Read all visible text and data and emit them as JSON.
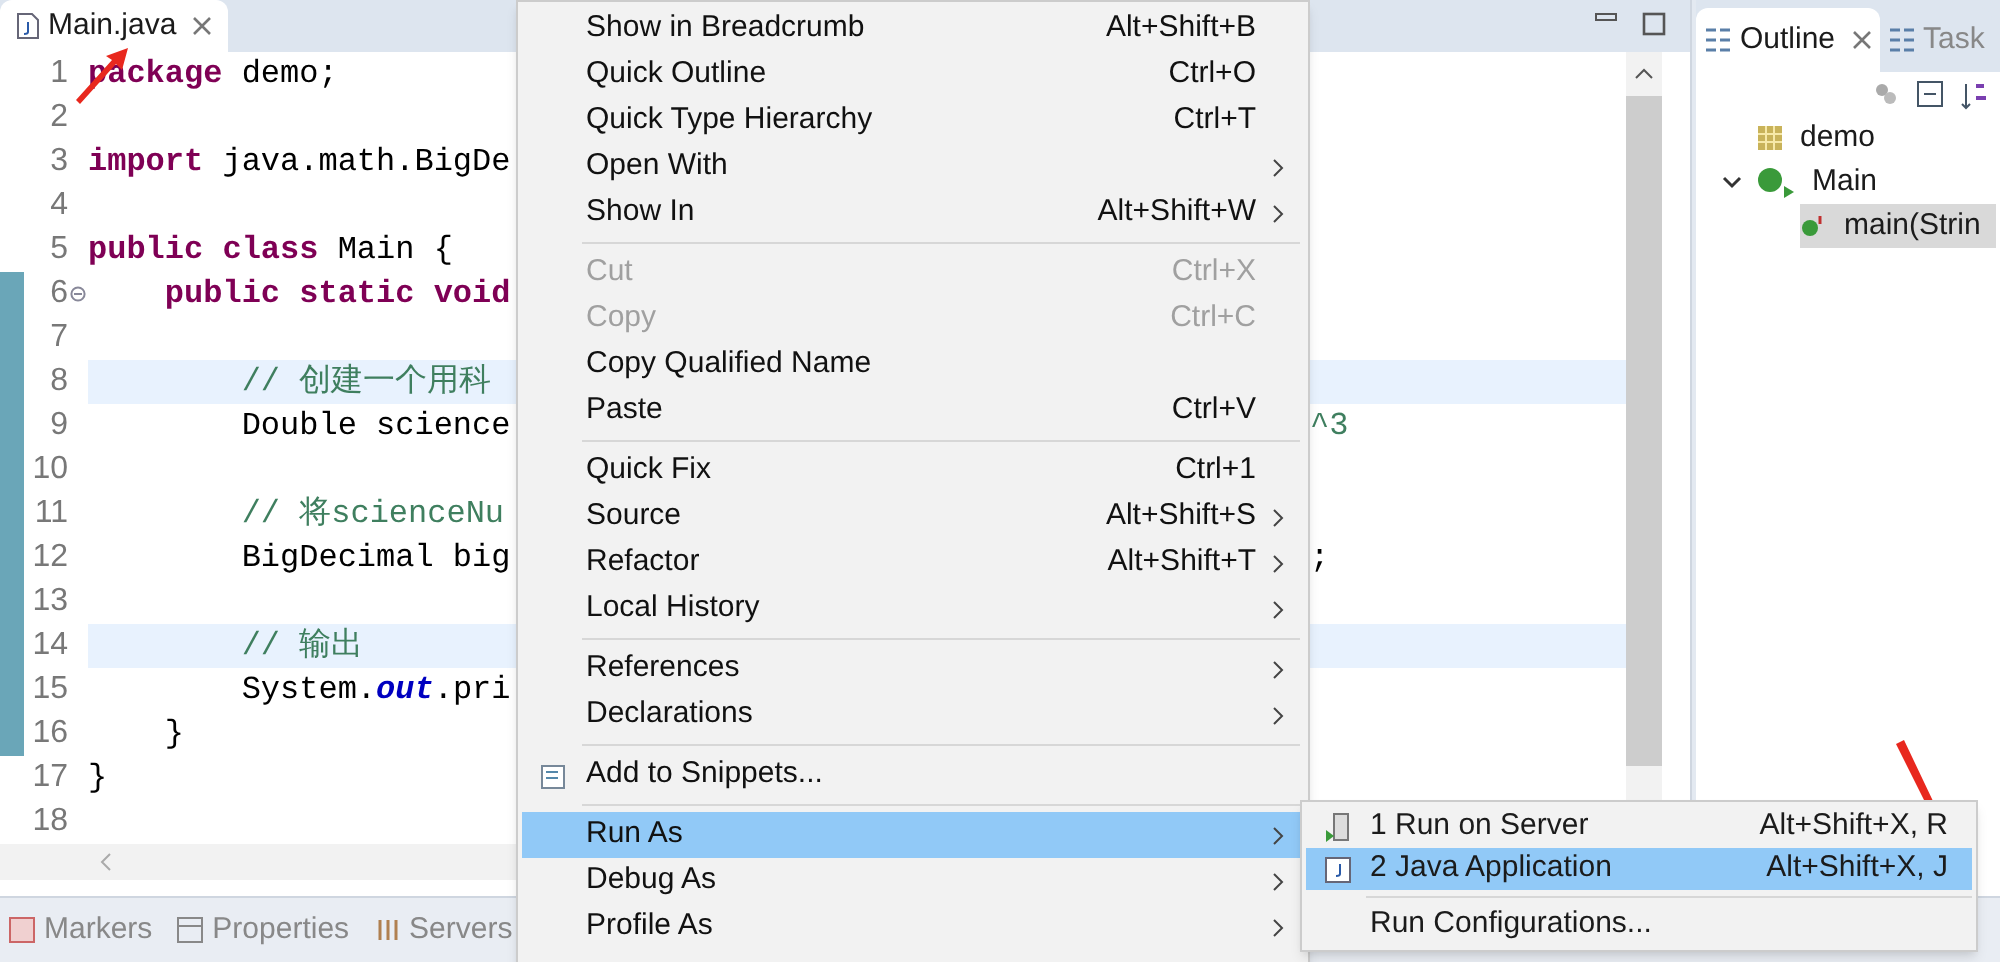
{
  "editor": {
    "tab": {
      "label": "Main.java",
      "closable": true
    },
    "lines": [
      {
        "number": "1",
        "tokens": [
          {
            "text": "package",
            "kind": "keyword"
          },
          {
            "text": " demo;",
            "kind": "plain"
          }
        ]
      },
      {
        "number": "2"
      },
      {
        "number": "3",
        "tokens": [
          {
            "text": "import",
            "kind": "keyword"
          },
          {
            "text": " java.math.BigDe",
            "kind": "plain"
          }
        ]
      },
      {
        "number": "4"
      },
      {
        "number": "5",
        "tokens": [
          {
            "text": "public class",
            "kind": "keyword"
          },
          {
            "text": " Main {",
            "kind": "plain"
          }
        ]
      },
      {
        "number": "6",
        "foldable": true,
        "changed": true,
        "tokens": [
          {
            "text": "    public static void",
            "kind": "keyword"
          }
        ]
      },
      {
        "number": "7",
        "changed": true
      },
      {
        "number": "8",
        "changed": true,
        "highlighted": true,
        "tokens": [
          {
            "text": "        // 创建一个用科",
            "kind": "comment"
          }
        ]
      },
      {
        "number": "9",
        "changed": true,
        "tokens": [
          {
            "text": "        Double science",
            "kind": "plain"
          }
        ],
        "tail": [
          {
            "text": "^3",
            "kind": "comment"
          }
        ]
      },
      {
        "number": "10",
        "changed": true
      },
      {
        "number": "11",
        "changed": true,
        "tokens": [
          {
            "text": "        // 将scienceNu",
            "kind": "comment"
          }
        ]
      },
      {
        "number": "12",
        "changed": true,
        "tokens": [
          {
            "text": "        BigDecimal big",
            "kind": "plain"
          }
        ],
        "tail": [
          {
            "text": ";",
            "kind": "plain"
          }
        ]
      },
      {
        "number": "13",
        "changed": true
      },
      {
        "number": "14",
        "changed": true,
        "highlighted": true,
        "tokens": [
          {
            "text": "        // 输出",
            "kind": "comment"
          }
        ]
      },
      {
        "number": "15",
        "changed": true,
        "tokens": [
          {
            "text": "        System.",
            "kind": "plain"
          },
          {
            "text": "out",
            "kind": "field"
          },
          {
            "text": ".pri",
            "kind": "plain"
          }
        ]
      },
      {
        "number": "16",
        "changed": true,
        "tokens": [
          {
            "text": "    }",
            "kind": "plain"
          }
        ]
      },
      {
        "number": "17",
        "tokens": [
          {
            "text": "}",
            "kind": "plain"
          }
        ]
      },
      {
        "number": "18"
      }
    ]
  },
  "outline": {
    "tabs": [
      {
        "label": "Outline",
        "selected": true,
        "closable": true
      },
      {
        "label": "Task",
        "selected": false,
        "closable": false
      }
    ],
    "tree": [
      {
        "label": "demo",
        "kind": "package"
      },
      {
        "label": "Main",
        "kind": "class",
        "expanded": true,
        "children": [
          {
            "label": "main(Strin",
            "kind": "method",
            "selected": true
          }
        ]
      }
    ]
  },
  "bottom_tabs": [
    {
      "label": "Markers",
      "kind": "markers"
    },
    {
      "label": "Properties",
      "kind": "properties"
    },
    {
      "label": "Servers",
      "kind": "servers"
    }
  ],
  "context_menu": {
    "groups": [
      [
        {
          "label": "Show in Breadcrumb",
          "shortcut": "Alt+Shift+B",
          "disabled": false,
          "submenu": false,
          "selected": false
        },
        {
          "label": "Quick Outline",
          "shortcut": "Ctrl+O",
          "disabled": false,
          "submenu": false,
          "selected": false
        },
        {
          "label": "Quick Type Hierarchy",
          "shortcut": "Ctrl+T",
          "disabled": false,
          "submenu": false,
          "selected": false
        },
        {
          "label": "Open With",
          "disabled": false,
          "submenu": true,
          "selected": false
        },
        {
          "label": "Show In",
          "shortcut": "Alt+Shift+W",
          "disabled": false,
          "submenu": true,
          "selected": false
        }
      ],
      [
        {
          "label": "Cut",
          "shortcut": "Ctrl+X",
          "disabled": true,
          "submenu": false,
          "selected": false
        },
        {
          "label": "Copy",
          "shortcut": "Ctrl+C",
          "disabled": true,
          "submenu": false,
          "selected": false
        },
        {
          "label": "Copy Qualified Name",
          "disabled": false,
          "submenu": false,
          "selected": false
        },
        {
          "label": "Paste",
          "shortcut": "Ctrl+V",
          "disabled": false,
          "submenu": false,
          "selected": false
        }
      ],
      [
        {
          "label": "Quick Fix",
          "shortcut": "Ctrl+1",
          "disabled": false,
          "submenu": false,
          "selected": false
        },
        {
          "label": "Source",
          "shortcut": "Alt+Shift+S",
          "disabled": false,
          "submenu": true,
          "selected": false
        },
        {
          "label": "Refactor",
          "shortcut": "Alt+Shift+T",
          "disabled": false,
          "submenu": true,
          "selected": false
        },
        {
          "label": "Local History",
          "disabled": false,
          "submenu": true,
          "selected": false
        }
      ],
      [
        {
          "label": "References",
          "disabled": false,
          "submenu": true,
          "selected": false
        },
        {
          "label": "Declarations",
          "disabled": false,
          "submenu": true,
          "selected": false
        }
      ],
      [
        {
          "label": "Add to Snippets...",
          "kind": "snippet",
          "disabled": false,
          "submenu": false,
          "selected": false
        }
      ],
      [
        {
          "label": "Run As",
          "disabled": false,
          "submenu": true,
          "selected": true
        },
        {
          "label": "Debug As",
          "disabled": false,
          "submenu": true,
          "selected": false
        },
        {
          "label": "Profile As",
          "disabled": false,
          "submenu": true,
          "selected": false
        }
      ]
    ]
  },
  "submenu": {
    "groups": [
      [
        {
          "label": "1 Run on Server",
          "shortcut": "Alt+Shift+X, R",
          "kind": "server",
          "selected": false
        },
        {
          "label": "2 Java Application",
          "shortcut": "Alt+Shift+X, J",
          "kind": "java",
          "selected": true
        }
      ],
      [
        {
          "label": "Run Configurations...",
          "kind": "plain",
          "selected": false
        }
      ]
    ]
  }
}
